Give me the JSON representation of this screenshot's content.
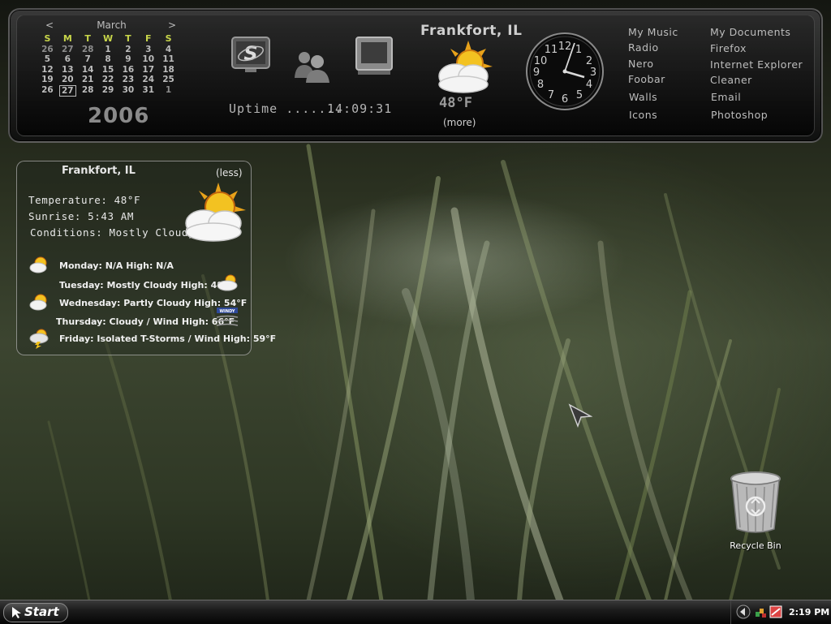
{
  "calendar": {
    "prev": "<",
    "next": ">",
    "month": "March",
    "year": "2006",
    "weekdays": [
      "S",
      "M",
      "T",
      "W",
      "T",
      "F",
      "S"
    ],
    "weeks": [
      [
        "26",
        "27",
        "28",
        "1",
        "2",
        "3",
        "4"
      ],
      [
        "5",
        "6",
        "7",
        "8",
        "9",
        "10",
        "11"
      ],
      [
        "12",
        "13",
        "14",
        "15",
        "16",
        "17",
        "18"
      ],
      [
        "19",
        "20",
        "21",
        "22",
        "23",
        "24",
        "25"
      ],
      [
        "26",
        "27",
        "28",
        "29",
        "30",
        "31",
        "1"
      ]
    ],
    "today": "27"
  },
  "uptime": {
    "label": "Uptime .......",
    "value": "14:09:31"
  },
  "top_weather": {
    "city": "Frankfort, IL",
    "temp": "48°F",
    "more": "(more)",
    "icon": "partly-cloudy-icon"
  },
  "clock_widget": {
    "hour_hand_time": "4:10",
    "numerals": [
      "12",
      "1",
      "2",
      "3",
      "4",
      "5",
      "6",
      "7",
      "8",
      "9",
      "10",
      "11"
    ]
  },
  "links": {
    "col1": [
      "My Music",
      "Radio",
      "Nero",
      "Foobar",
      "Walls",
      "Icons"
    ],
    "col2": [
      "My Documents",
      "Firefox",
      "Internet Explorer",
      "Cleaner",
      "Email",
      "Photoshop"
    ]
  },
  "weather_panel": {
    "city": "Frankfort, IL",
    "less": "(less)",
    "temperature": "Temperature: 48°F",
    "sunrise": "Sunrise: 5:43 AM",
    "conditions": "Conditions: Mostly Cloudy",
    "forecast": [
      "Monday: N/A High: N/A",
      "Tuesday: Mostly Cloudy High: 48°F",
      "Wednesday: Partly Cloudy High: 54°F",
      "Thursday: Cloudy / Wind High: 66°F",
      "Friday: Isolated T-Storms / Wind High: 59°F"
    ],
    "windy_badge": "WINDY"
  },
  "desktop": {
    "recycle_bin": "Recycle Bin"
  },
  "taskbar": {
    "start": "Start",
    "time": "2:19 PM"
  }
}
